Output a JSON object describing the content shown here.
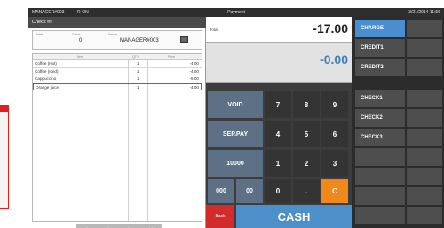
{
  "topbar": {
    "user": "MANAGER#003",
    "status": "R-ON",
    "title": "Payment",
    "clock": "3/21/2014 11:56"
  },
  "ticket": {
    "header": "Check  ✉",
    "table_label": "Table",
    "guest_label": "Guest",
    "guest_value": "0",
    "server_label": "Server",
    "server_value": "MANAGER#003",
    "columns": [
      "Item",
      "QTY",
      "Price"
    ],
    "rows": [
      {
        "item": "Coffee (Hot)",
        "qty": "1",
        "price": "-4.00"
      },
      {
        "item": "Coffee (Iced)",
        "qty": "1",
        "price": "-4.00"
      },
      {
        "item": "Cappuccino",
        "qty": "1",
        "price": "-5.00"
      },
      {
        "item": "Orange juice",
        "qty": "1",
        "price": "-4.00"
      }
    ],
    "scroll_up_icon": "˄",
    "scroll_down_icon": "˅"
  },
  "total": {
    "label": "Total",
    "amount": "-17.00"
  },
  "change": {
    "amount": "-0.00"
  },
  "keys": {
    "void": "VOID",
    "seppay": "SEP.PAY",
    "k10000": "10000",
    "k000": "000",
    "k00": "00",
    "n7": "7",
    "n8": "8",
    "n9": "9",
    "n4": "4",
    "n5": "5",
    "n6": "6",
    "n1": "1",
    "n2": "2",
    "n3": "3",
    "n0": "0",
    "dot": ".",
    "clear": "C",
    "back": "Back",
    "cash": "CASH"
  },
  "payments": [
    "CHARGE",
    "CREDIT1",
    "CREDIT2",
    "CHECK1",
    "CHECK2",
    "CHECK3"
  ],
  "colors": {
    "accent": "#4b8ecf",
    "clear": "#f0891a",
    "back": "#d22b2b",
    "function_key": "#5e7086"
  }
}
